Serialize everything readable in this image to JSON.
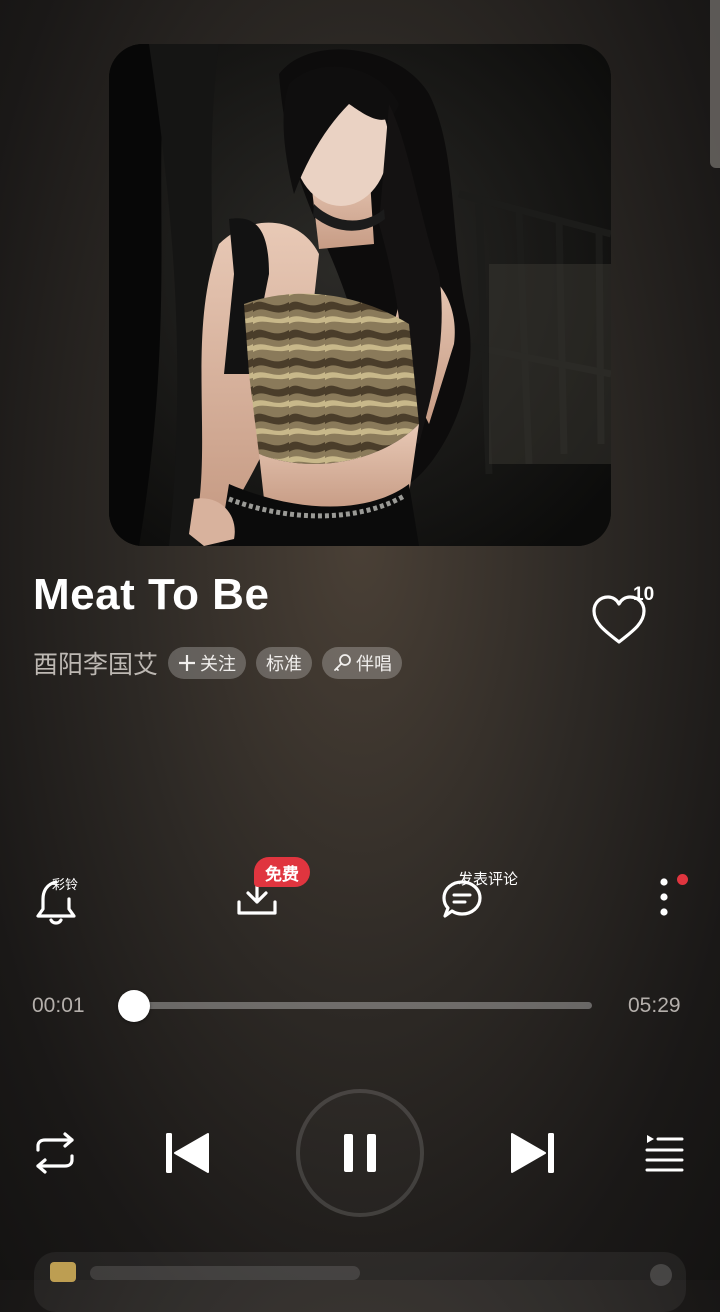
{
  "song": {
    "title": "Meat To Be",
    "artist": "酉阳李国艾",
    "like_count": "10",
    "tags": {
      "follow": "关注",
      "quality": "标准",
      "accompany": "伴唱"
    }
  },
  "actions": {
    "ringtone_label": "彩铃",
    "download_badge": "免费",
    "comment_label": "发表评论"
  },
  "progress": {
    "current": "00:01",
    "total": "05:29",
    "fraction": 0.003
  },
  "player": {
    "state": "playing"
  },
  "colors": {
    "accent_red": "#e0353f",
    "text_secondary": "#bdb8b3"
  },
  "icons": [
    "bell-icon",
    "download-icon",
    "comment-icon",
    "more-icon",
    "heart-icon",
    "repeat-icon",
    "previous-icon",
    "pause-icon",
    "next-icon",
    "playlist-icon",
    "microphone-icon",
    "plus-icon"
  ]
}
